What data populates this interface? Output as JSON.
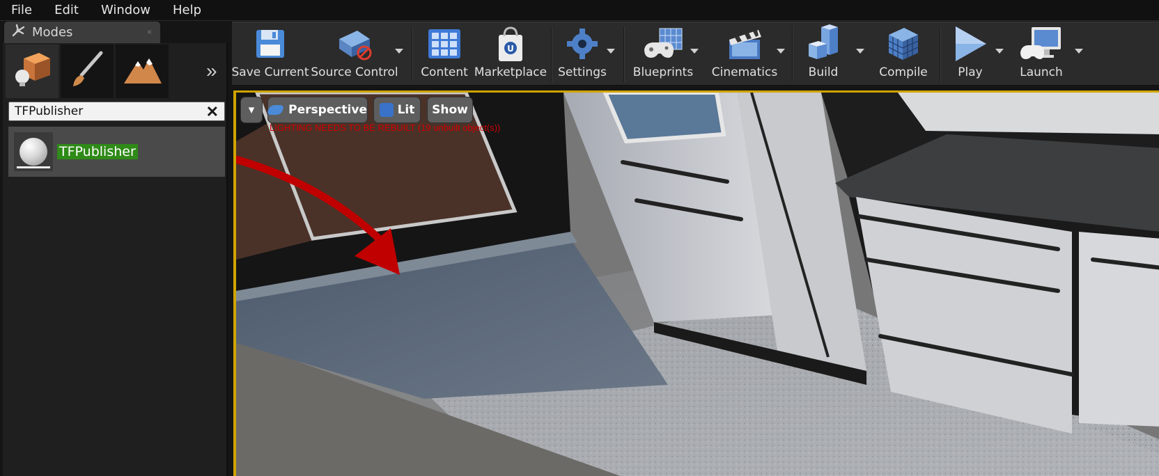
{
  "menu": {
    "items": [
      "File",
      "Edit",
      "Window",
      "Help"
    ]
  },
  "modes": {
    "tab_label": "Modes",
    "tab_close": "×",
    "buttons": [
      "place-mode",
      "paint-mode",
      "landscape-mode"
    ],
    "expand_glyph": "»",
    "search": {
      "value": "TFPublisher",
      "clear_glyph": "✕"
    },
    "result": {
      "label": "TFPublisher"
    }
  },
  "toolbar": {
    "buttons": [
      {
        "label": "Save Current",
        "icon": "floppy-disk-icon"
      },
      {
        "label": "Source Control",
        "icon": "source-control-icon"
      },
      {
        "label": "Content",
        "icon": "content-grid-icon"
      },
      {
        "label": "Marketplace",
        "icon": "marketplace-bag-icon"
      },
      {
        "label": "Settings",
        "icon": "gear-icon"
      },
      {
        "label": "Blueprints",
        "icon": "blueprint-gamepad-icon"
      },
      {
        "label": "Cinematics",
        "icon": "clapperboard-icon"
      },
      {
        "label": "Build",
        "icon": "build-blocks-icon"
      },
      {
        "label": "Compile",
        "icon": "compile-cubes-icon"
      },
      {
        "label": "Play",
        "icon": "play-icon"
      },
      {
        "label": "Launch",
        "icon": "launch-monitor-icon"
      }
    ]
  },
  "viewport": {
    "options_glyph": "▾",
    "perspective": "Perspective",
    "lit": "Lit",
    "show": "Show",
    "warning": "LIGHTING NEEDS TO BE REBUILT (19 unbuilt object(s))"
  },
  "colors": {
    "accent_border": "#d0a400",
    "highlight_green": "#2f8a18",
    "warning_red": "#d40000",
    "annotation_arrow": "#c00000"
  }
}
